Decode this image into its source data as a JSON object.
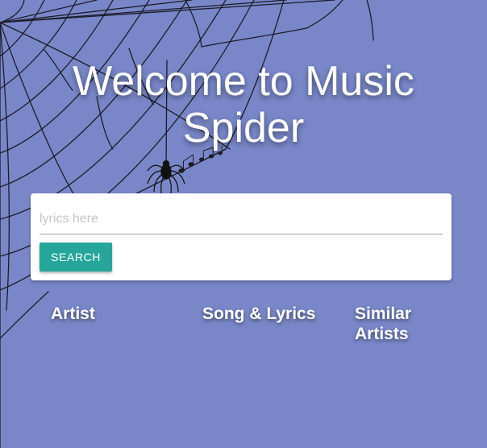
{
  "header": {
    "title_line1": "Welcome to Music",
    "title_line2": "Spider"
  },
  "search": {
    "placeholder": "lyrics here",
    "value": "",
    "button_label": "SEARCH"
  },
  "columns": {
    "artist": "Artist",
    "song_lyrics": "Song & Lyrics",
    "similar_artists": "Similar Artists"
  },
  "colors": {
    "background": "#7987c9",
    "button": "#26a69a",
    "text": "#ffffff"
  },
  "icons": [
    "spider-web-icon",
    "spider-icon",
    "music-notes-icon"
  ]
}
